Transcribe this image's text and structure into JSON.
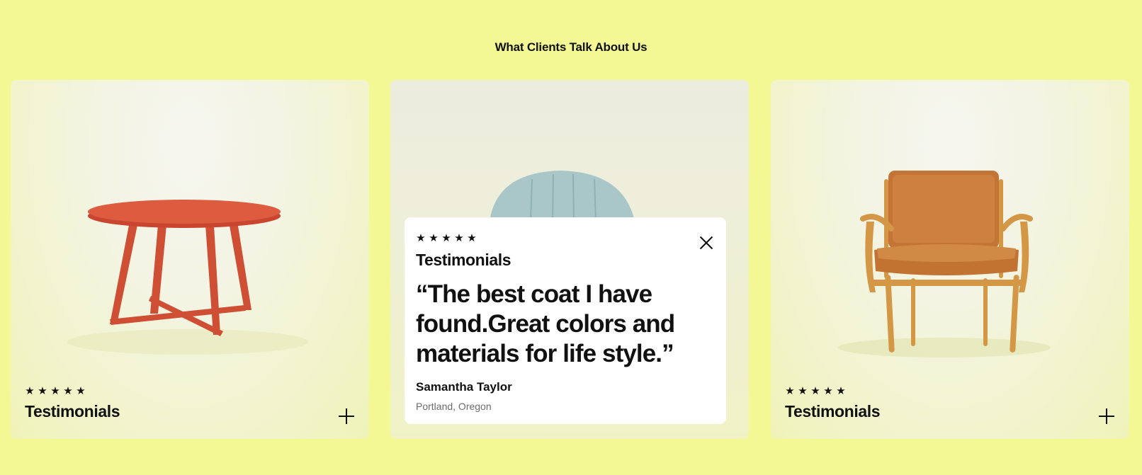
{
  "section": {
    "title": "What Clients Talk About Us"
  },
  "cards": [
    {
      "image": "red-round-table",
      "stars": [
        "★",
        "★",
        "★",
        "★",
        "★"
      ],
      "label": "Testimonials",
      "action_icon": "plus-icon"
    },
    {
      "image": "light-blue-armchair",
      "popup": {
        "stars": [
          "★",
          "★",
          "★",
          "★",
          "★"
        ],
        "label": "Testimonials",
        "quote": "“The best coat I have found.Great colors and materials for life style.”",
        "author": "Samantha Taylor",
        "location": "Portland, Oregon",
        "close_icon": "close-icon"
      }
    },
    {
      "image": "tan-leather-armchair",
      "stars": [
        "★",
        "★",
        "★",
        "★",
        "★"
      ],
      "label": "Testimonials",
      "action_icon": "plus-icon"
    }
  ],
  "colors": {
    "background": "#f3f794",
    "popup": "#ffffff",
    "table": "#d9573c",
    "blue_chair": "#a7c5c6",
    "leather": "#c97a3a",
    "wood": "#d59a47"
  }
}
